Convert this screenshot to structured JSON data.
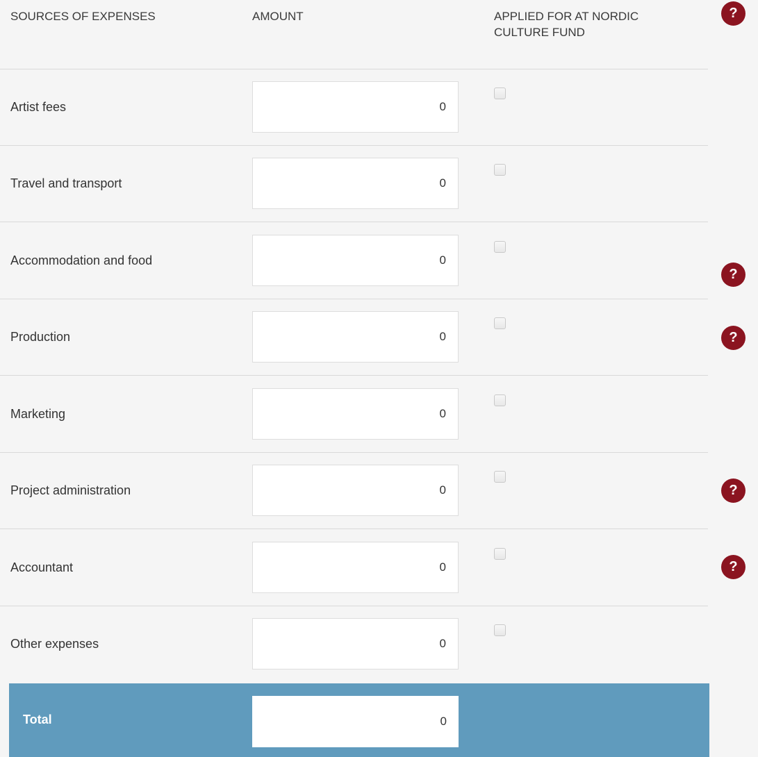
{
  "header": {
    "col_source": "SOURCES OF EXPENSES",
    "col_amount": "AMOUNT",
    "col_applied": "APPLIED FOR AT NORDIC CULTURE FUND",
    "help_icon": "?"
  },
  "rows": [
    {
      "label": "Artist fees",
      "amount": "0",
      "applied": false
    },
    {
      "label": "Travel and transport",
      "amount": "0",
      "applied": false
    },
    {
      "label": "Accommodation and food",
      "amount": "0",
      "applied": false,
      "help_icon": "?"
    },
    {
      "label": "Production",
      "amount": "0",
      "applied": false,
      "help_icon": "?"
    },
    {
      "label": "Marketing",
      "amount": "0",
      "applied": false
    },
    {
      "label": "Project administration",
      "amount": "0",
      "applied": false,
      "help_icon": "?"
    },
    {
      "label": "Accountant",
      "amount": "0",
      "applied": false,
      "help_icon": "?"
    },
    {
      "label": "Other expenses",
      "amount": "0",
      "applied": false
    }
  ],
  "total": {
    "label": "Total",
    "amount": "0"
  },
  "colors": {
    "help_icon_bg": "#8b1420",
    "total_bg": "#609bbd",
    "page_bg": "#f5f5f5"
  }
}
